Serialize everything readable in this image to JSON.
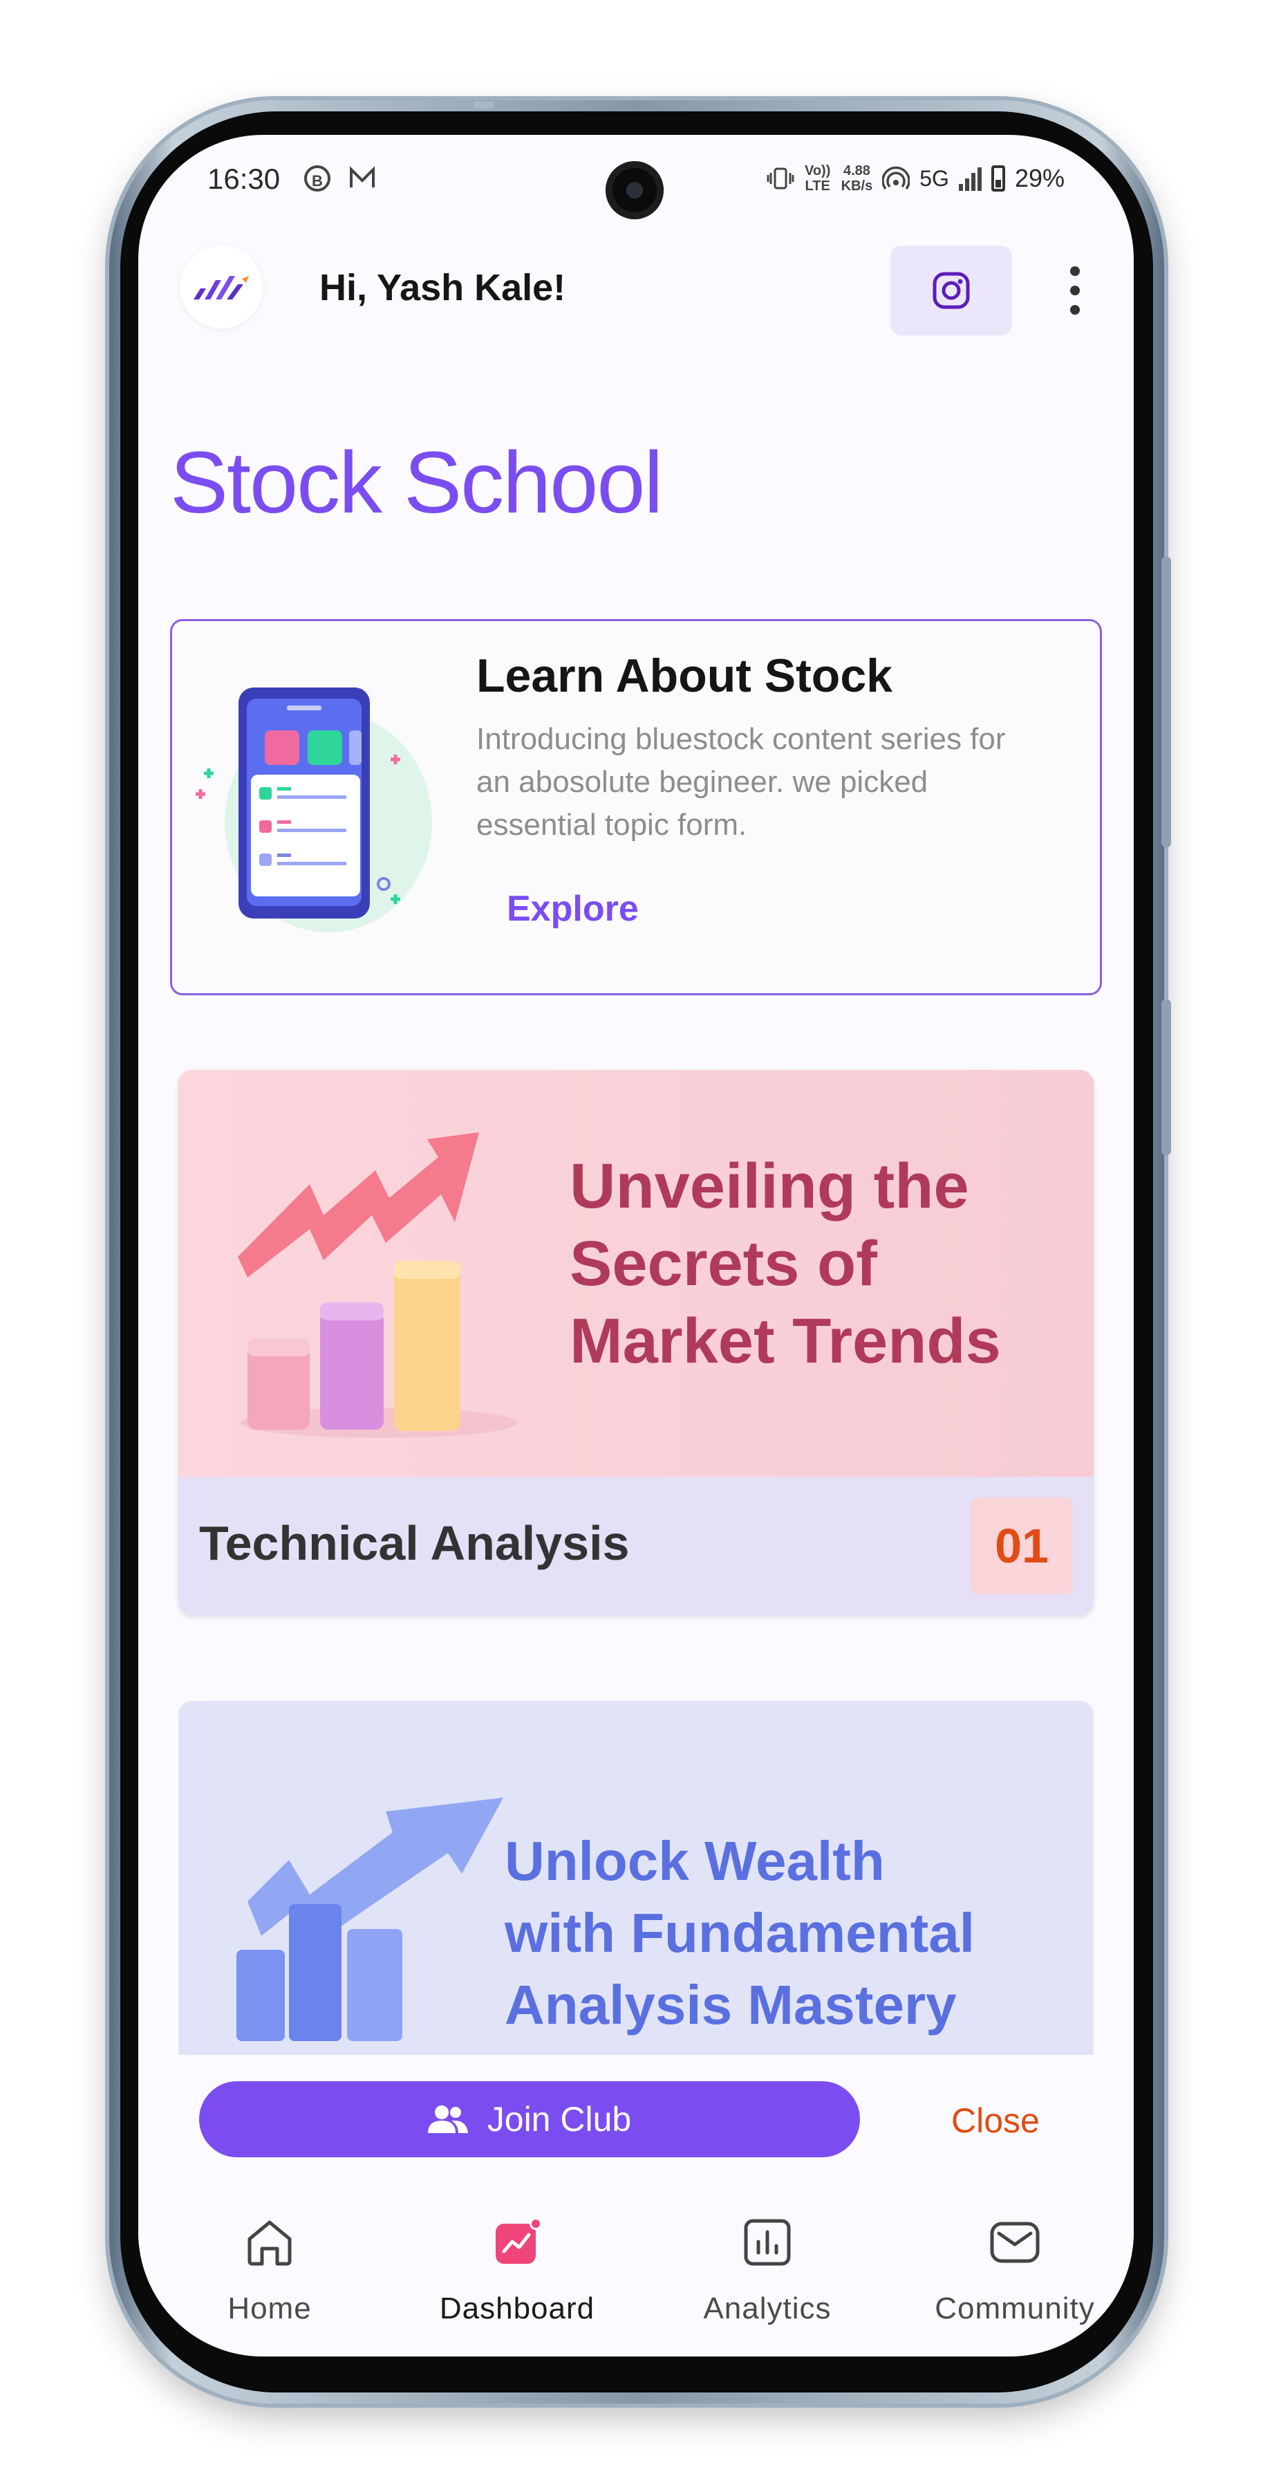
{
  "status_bar": {
    "time": "16:30",
    "icons": [
      "b-circle-icon",
      "mail-icon",
      "vibrate-icon",
      "volte-icon",
      "hotspot-icon",
      "5g-icon",
      "signal-icon",
      "battery-icon"
    ],
    "volte_label": "Vo)) LTE",
    "net_speed": "4.88",
    "net_speed_unit": "KB/s",
    "network": "5G",
    "battery": "29%"
  },
  "header": {
    "greeting": "Hi, Yash Kale!",
    "instagram_icon": "instagram-icon",
    "menu_icon": "more-vertical-icon"
  },
  "page_title": "Stock School",
  "learn_card": {
    "title": "Learn About Stock",
    "description": "Introducing bluestock content series for an abosolute begineer. we picked essential topic form.",
    "cta": "Explore"
  },
  "courses": [
    {
      "banner_title": "Unveiling the Secrets of Market Trends",
      "banner_lines": [
        "Unveiling the",
        "Secrets of",
        "Market Trends"
      ],
      "name": "Technical Analysis",
      "number": "01"
    },
    {
      "banner_title": "Unlock Wealth with Fundamental Analysis Mastery",
      "banner_lines": [
        "Unlock Wealth",
        "with Fundamental",
        "Analysis Mastery"
      ]
    }
  ],
  "actions": {
    "join": "Join Club",
    "close": "Close"
  },
  "nav": [
    {
      "label": "Home",
      "icon": "home-icon"
    },
    {
      "label": "Dashboard",
      "icon": "dashboard-chart-icon",
      "active": true
    },
    {
      "label": "Analytics",
      "icon": "analytics-icon"
    },
    {
      "label": "Community",
      "icon": "community-mail-icon"
    }
  ],
  "colors": {
    "accent": "#7b4df0",
    "close": "#e14b14",
    "technical_banner_text": "#b03a5a",
    "fundamental_banner_text": "#5a6fe0",
    "dashboard_icon": "#f0457a"
  }
}
